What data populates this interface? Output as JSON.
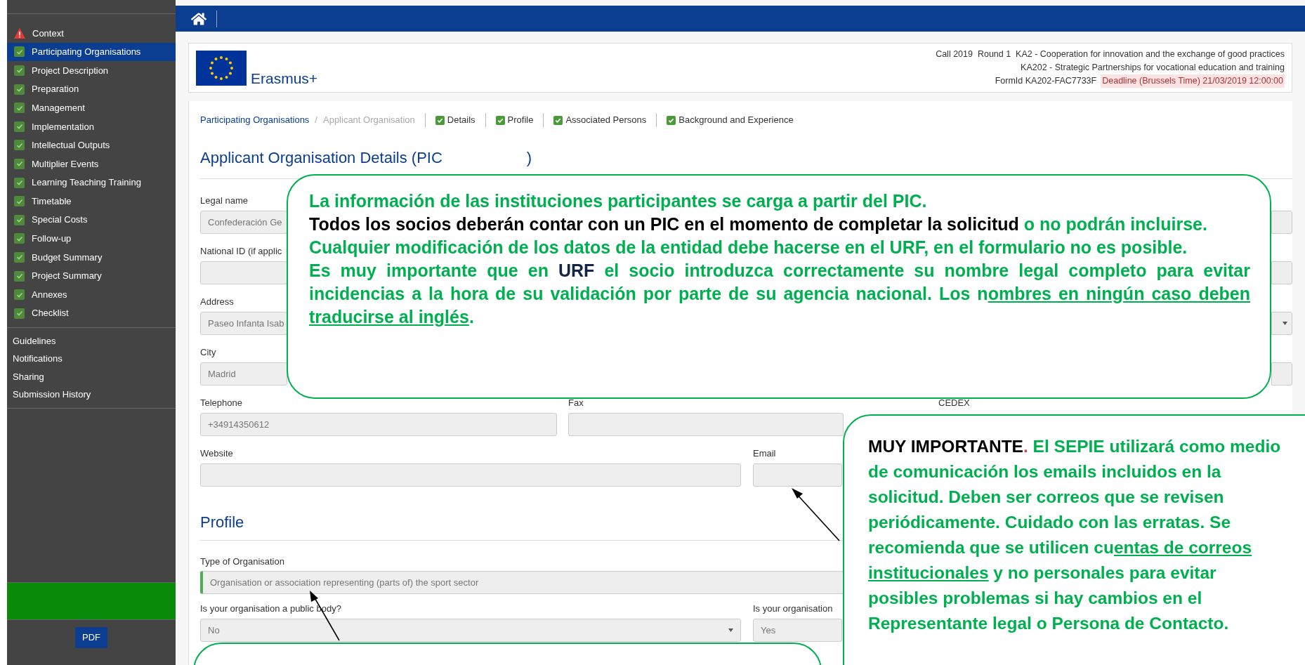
{
  "sidebar": {
    "sections": [
      {
        "label": "Context",
        "kind": "warning",
        "selected": false
      },
      {
        "label": "Participating Organisations",
        "kind": "done",
        "selected": true
      },
      {
        "label": "Project Description",
        "kind": "done",
        "selected": false
      },
      {
        "label": "Preparation",
        "kind": "done",
        "selected": false
      },
      {
        "label": "Management",
        "kind": "done",
        "selected": false
      },
      {
        "label": "Implementation",
        "kind": "done",
        "selected": false
      },
      {
        "label": "Intellectual Outputs",
        "kind": "done",
        "selected": false
      },
      {
        "label": "Multiplier Events",
        "kind": "done",
        "selected": false
      },
      {
        "label": "Learning Teaching Training",
        "kind": "done",
        "selected": false
      },
      {
        "label": "Timetable",
        "kind": "done",
        "selected": false
      },
      {
        "label": "Special Costs",
        "kind": "done",
        "selected": false
      },
      {
        "label": "Follow-up",
        "kind": "done",
        "selected": false
      },
      {
        "label": "Budget Summary",
        "kind": "done",
        "selected": false
      },
      {
        "label": "Project Summary",
        "kind": "done",
        "selected": false
      },
      {
        "label": "Annexes",
        "kind": "done",
        "selected": false
      },
      {
        "label": "Checklist",
        "kind": "done",
        "selected": false
      }
    ],
    "links": [
      "Guidelines",
      "Notifications",
      "Sharing",
      "Submission History"
    ],
    "pdf_button": "PDF"
  },
  "header": {
    "logo_text": "Erasmus+",
    "call_line": "Call 2019  Round 1  KA2 - Cooperation for innovation and the exchange of good practices",
    "action_line": "KA202 - Strategic Partnerships for vocational education and training",
    "form_id": "FormId KA202-FAC7733F",
    "deadline": "Deadline (Brussels Time) 21/03/2019 12:00:00"
  },
  "breadcrumb": {
    "items": [
      "Participating Organisations",
      "Applicant Organisation"
    ],
    "separator": "/",
    "tabs": [
      {
        "label": "Details",
        "checked": true
      },
      {
        "label": "Profile",
        "checked": true
      },
      {
        "label": "Associated Persons",
        "checked": true
      },
      {
        "label": "Background and Experience",
        "checked": true
      }
    ]
  },
  "title": {
    "start": "Applicant Organisation Details (PIC",
    "end": ")"
  },
  "rows": [
    [
      {
        "label": "Legal name",
        "value": "Confederación Ge",
        "kind": "input"
      }
    ],
    [
      {
        "label": "National ID (if applic",
        "kind": "input"
      }
    ],
    [
      {
        "label": "Address",
        "value": "Paseo Infanta Isab",
        "kind": "select"
      }
    ],
    [
      {
        "label": "City",
        "value": "Madrid",
        "kind": "input"
      }
    ],
    [
      {
        "label": "Telephone",
        "value": "+34914350612",
        "kind": "input"
      },
      {
        "label": "Fax",
        "kind": "input"
      },
      {
        "label": "CEDEX"
      }
    ],
    [
      {
        "label": "Website",
        "kind": "input"
      },
      {
        "label": "Email",
        "kind": "input"
      }
    ]
  ],
  "profile": {
    "heading": "Profile",
    "type_label": "Type of Organisation",
    "type_value": "Organisation or association representing (parts of) the sport sector",
    "rows": [
      {
        "label": "Is your organisation a public body?",
        "value": "No",
        "kind": "select"
      },
      {
        "label": "Is your organisation",
        "value": "Yes",
        "kind": "input"
      }
    ]
  },
  "callouts": [
    {
      "paragraphs": [
        [
          {
            "text": "La información de las instituciones participantes se carga a partir del PIC.",
            "color": "#00b050",
            "underline": false
          }
        ],
        [
          {
            "text": "Todos los socios deberán contar con un PIC en el momento de completar la solicitud",
            "color": "#000000",
            "underline": false
          },
          {
            "text": " o no podrán incluirse.",
            "color": "#00b050",
            "underline": false
          }
        ],
        [
          {
            "text": "Cualquier modificación de los datos de la entidad debe hacerse en el URF, en el formulario no es posible.",
            "color": "#00b050",
            "underline": false
          }
        ],
        [
          {
            "text": "Es muy importante que en ",
            "color": "#00b050",
            "underline": false
          },
          {
            "text": "URF",
            "color": "#14254a",
            "underline": false
          },
          {
            "text": " el socio introduzca correctamente su nombre legal completo para evitar incidencias a la hora de su validación por parte de su agencia nacional. Los n",
            "color": "#00b050",
            "underline": false
          },
          {
            "text": "ombres en ningún caso deben traducirse al inglés",
            "color": "#00b050",
            "underline": true
          },
          {
            "text": ".",
            "color": "#00b050",
            "underline": false
          }
        ]
      ]
    },
    {
      "paragraphs": [
        [
          {
            "text": "MUY IMPORTANTE",
            "color": "#000000",
            "underline": false
          },
          {
            "text": ".",
            "color": "#c0504d",
            "underline": false
          },
          {
            "text": "  El SEPIE utilizará como medio de comunicación los emails incluidos en la solicitud. Deben ser correos que se revisen periódicamente. Cuidado con las erratas. Se recomienda que se utilicen cu",
            "color": "#00b050",
            "underline": false
          },
          {
            "text": "entas de correos institucionales",
            "color": "#00b050",
            "underline": true
          },
          {
            "text": " y no personales para evitar posibles problemas si hay cambios en el Representante legal o Persona de Contacto.",
            "color": "#00b050",
            "underline": false
          }
        ]
      ]
    }
  ],
  "bottom_callout": true
}
